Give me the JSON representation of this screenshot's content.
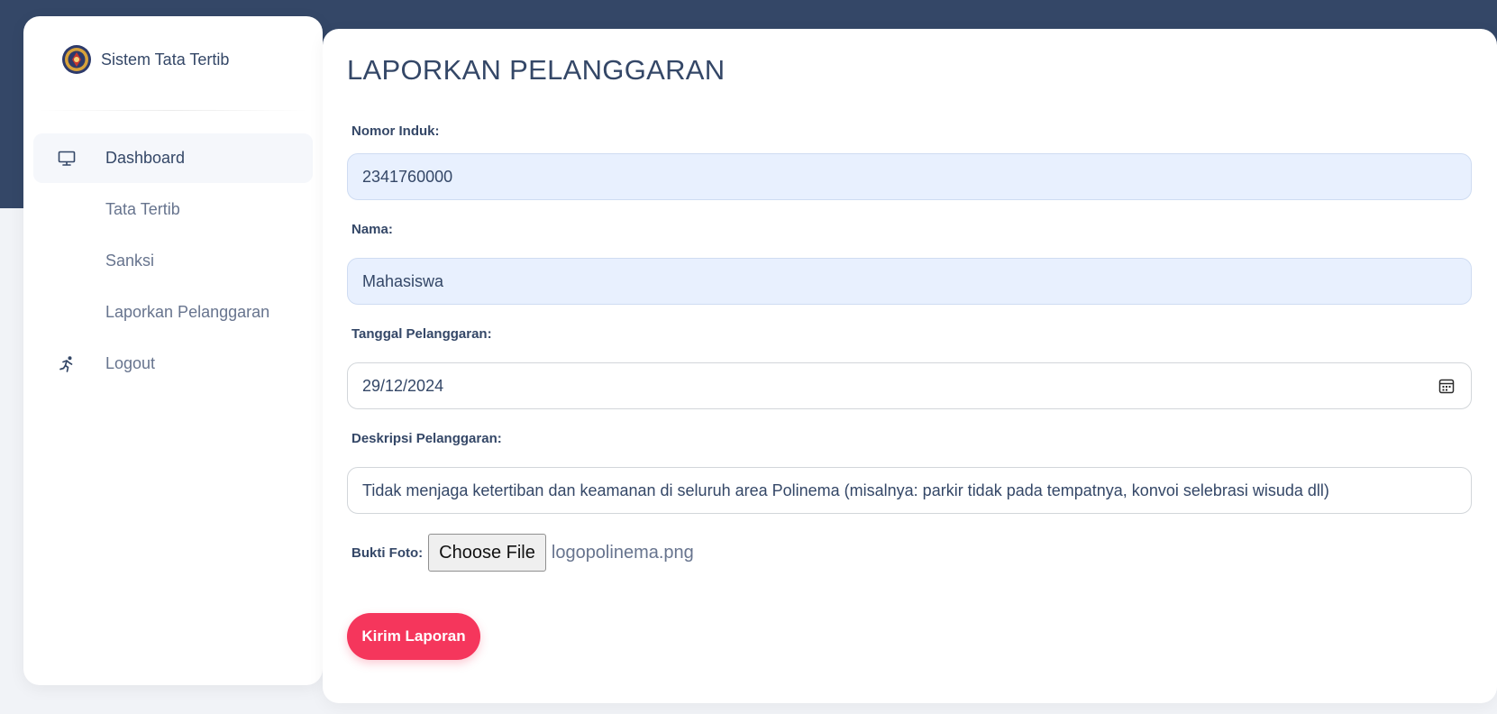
{
  "brand": {
    "name": "Sistem Tata Tertib",
    "logo_icon": "polinema-logo-icon"
  },
  "sidebar": {
    "items": [
      {
        "label": "Dashboard",
        "icon": "monitor-icon",
        "active": true
      },
      {
        "label": "Tata Tertib",
        "icon": null,
        "active": false
      },
      {
        "label": "Sanksi",
        "icon": null,
        "active": false
      },
      {
        "label": "Laporkan Pelanggaran",
        "icon": null,
        "active": false
      },
      {
        "label": "Logout",
        "icon": "running-person-icon",
        "active": false
      }
    ]
  },
  "main": {
    "title": "LAPORKAN PELANGGARAN",
    "form": {
      "nomor_induk": {
        "label": "Nomor Induk:",
        "value": "2341760000"
      },
      "nama": {
        "label": "Nama:",
        "value": "Mahasiswa"
      },
      "tanggal": {
        "label": "Tanggal Pelanggaran:",
        "value": "29/12/2024"
      },
      "deskripsi": {
        "label": "Deskripsi Pelanggaran:",
        "value": "Tidak menjaga ketertiban dan keamanan di seluruh area Polinema (misalnya: parkir tidak pada tempatnya, konvoi selebrasi wisuda dll)"
      },
      "bukti": {
        "label": "Bukti Foto:",
        "button_label": "Choose File",
        "file_name": "logopolinema.png"
      },
      "submit_label": "Kirim Laporan"
    }
  },
  "colors": {
    "header_band": "#344767",
    "text_primary": "#344767",
    "text_muted": "#67748e",
    "autofill_bg": "#e8f0fe",
    "submit": "#f5365c"
  }
}
